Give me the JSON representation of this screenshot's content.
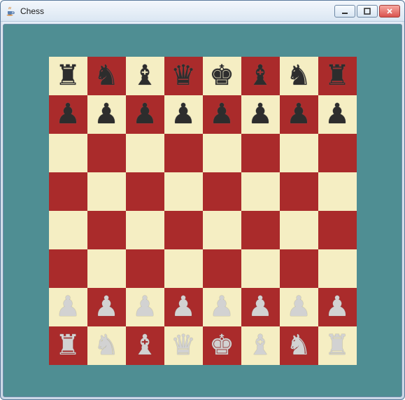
{
  "window": {
    "title": "Chess",
    "icon_name": "java-cup-icon"
  },
  "piece_glyphs": {
    "K": "♚",
    "Q": "♛",
    "R": "♜",
    "B": "♝",
    "N": "♞",
    "P": "♟"
  },
  "board": {
    "light_color": "#f5eec3",
    "dark_color": "#aa2b2b",
    "background_color": "#4f8e93",
    "rows": [
      [
        {
          "piece": "R",
          "color": "black"
        },
        {
          "piece": "N",
          "color": "black"
        },
        {
          "piece": "B",
          "color": "black"
        },
        {
          "piece": "Q",
          "color": "black"
        },
        {
          "piece": "K",
          "color": "black"
        },
        {
          "piece": "B",
          "color": "black"
        },
        {
          "piece": "N",
          "color": "black"
        },
        {
          "piece": "R",
          "color": "black"
        }
      ],
      [
        {
          "piece": "P",
          "color": "black"
        },
        {
          "piece": "P",
          "color": "black"
        },
        {
          "piece": "P",
          "color": "black"
        },
        {
          "piece": "P",
          "color": "black"
        },
        {
          "piece": "P",
          "color": "black"
        },
        {
          "piece": "P",
          "color": "black"
        },
        {
          "piece": "P",
          "color": "black"
        },
        {
          "piece": "P",
          "color": "black"
        }
      ],
      [
        null,
        null,
        null,
        null,
        null,
        null,
        null,
        null
      ],
      [
        null,
        null,
        null,
        null,
        null,
        null,
        null,
        null
      ],
      [
        null,
        null,
        null,
        null,
        null,
        null,
        null,
        null
      ],
      [
        null,
        null,
        null,
        null,
        null,
        null,
        null,
        null
      ],
      [
        {
          "piece": "P",
          "color": "white"
        },
        {
          "piece": "P",
          "color": "white"
        },
        {
          "piece": "P",
          "color": "white"
        },
        {
          "piece": "P",
          "color": "white"
        },
        {
          "piece": "P",
          "color": "white"
        },
        {
          "piece": "P",
          "color": "white"
        },
        {
          "piece": "P",
          "color": "white"
        },
        {
          "piece": "P",
          "color": "white"
        }
      ],
      [
        {
          "piece": "R",
          "color": "white"
        },
        {
          "piece": "N",
          "color": "white"
        },
        {
          "piece": "B",
          "color": "white"
        },
        {
          "piece": "Q",
          "color": "white"
        },
        {
          "piece": "K",
          "color": "white"
        },
        {
          "piece": "B",
          "color": "white"
        },
        {
          "piece": "N",
          "color": "white"
        },
        {
          "piece": "R",
          "color": "white"
        }
      ]
    ]
  }
}
